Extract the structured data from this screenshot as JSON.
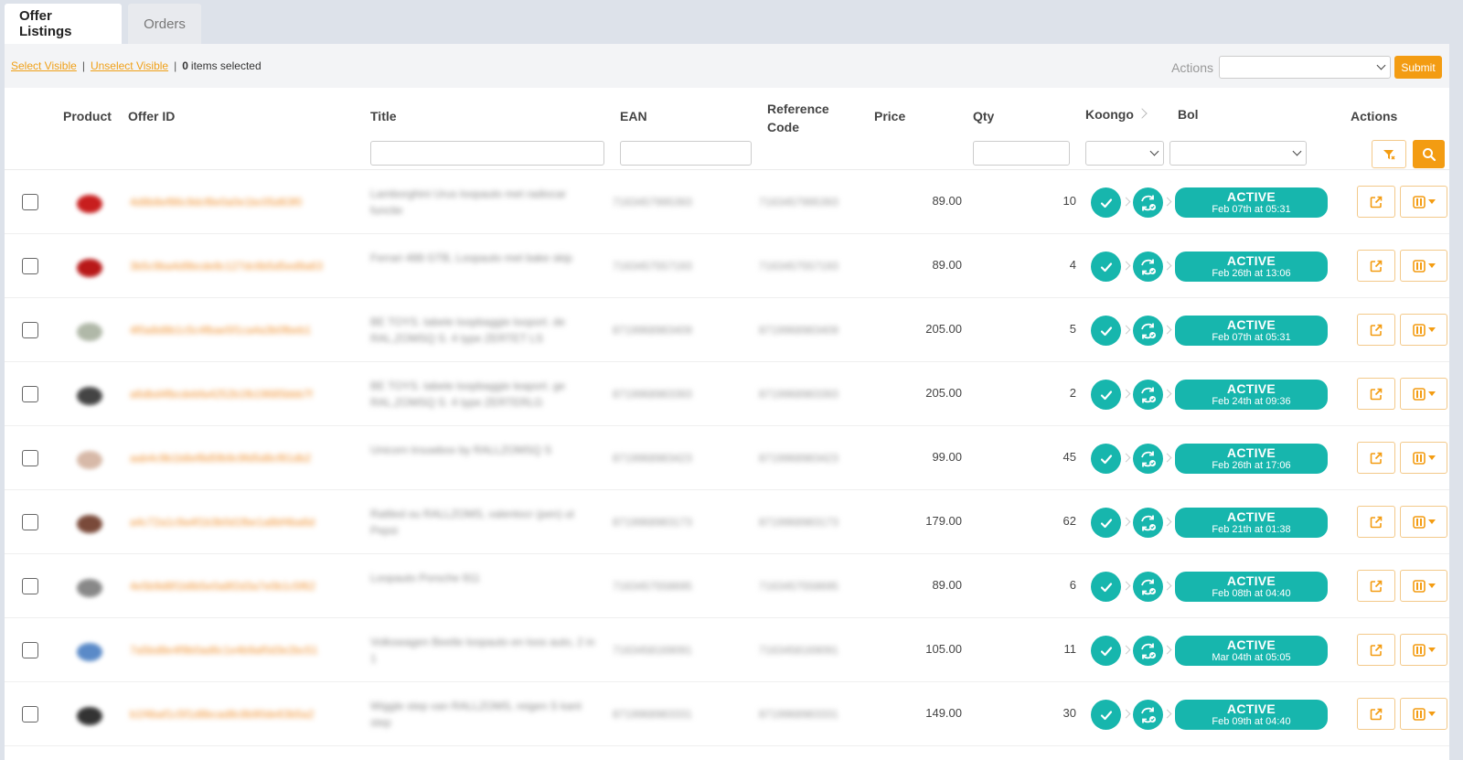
{
  "tabs": [
    {
      "label": "Offer Listings",
      "active": true
    },
    {
      "label": "Orders",
      "active": false
    }
  ],
  "toolbar": {
    "select_visible": "Select Visible",
    "unselect_visible": "Unselect Visible",
    "separator": "|",
    "selected_count": "0",
    "selected_suffix": "items selected",
    "actions_label": "Actions",
    "actions_value": "",
    "submit_label": "Submit"
  },
  "columns": {
    "product": "Product",
    "offer_id": "Offer ID",
    "title": "Title",
    "ean": "EAN",
    "reference_code_line1": "Reference",
    "reference_code_line2": "Code",
    "price": "Price",
    "qty": "Qty",
    "koongo": "Koongo",
    "bol": "Bol",
    "actions": "Actions"
  },
  "colors": {
    "accent": "#f39c12",
    "link": "#f0a018",
    "status_teal": "#17b6ad"
  },
  "rows": [
    {
      "thumb_color": "#c81e1e",
      "offer_id": "4d8b8ef86c9dcf8e0a0e1bc05d63f0",
      "title": "Lamborghini Urus loopauto met radiocar functie",
      "ean": "7163457995393",
      "ref": "7163457995393",
      "price": "89.00",
      "qty": "10",
      "status": "ACTIVE",
      "date": "Feb 07th at 05:31"
    },
    {
      "thumb_color": "#b81818",
      "offer_id": "3b5c9ba4d9bcde8c127dc6b5d5ed9a63",
      "title": "Ferrari 488 GTB, Loopauto met bake skip",
      "ean": "7163457557193",
      "ref": "7163457557193",
      "price": "89.00",
      "qty": "4",
      "status": "ACTIVE",
      "date": "Feb 26th at 13:06"
    },
    {
      "thumb_color": "#b0b8a8",
      "offer_id": "4f0a8d8b1c5c4fbae5f1ca4a3b0fbeb1",
      "title": "BE TOYS. tabele loopbaggie looport. de RAL,ZOMSQ S. 4 type ZERTET LS",
      "ean": "8719968983409",
      "ref": "8719968983409",
      "price": "205.00",
      "qty": "5",
      "status": "ACTIVE",
      "date": "Feb 07th at 05:31"
    },
    {
      "thumb_color": "#444444",
      "offer_id": "a6dbd4fbcdebfa4252b1fb19685bbb7f",
      "title": "BE TOYS. tabele loopbaggie leaport. ge RAL,ZOMSQ S. 4 type ZERTERLG",
      "ean": "8719968983393",
      "ref": "8719968983393",
      "price": "205.00",
      "qty": "2",
      "status": "ACTIVE",
      "date": "Feb 24th at 09:36"
    },
    {
      "thumb_color": "#d7b9a8",
      "offer_id": "aab4c9b1b8ef8d5fb9c9fd5d8cf81db2",
      "title": "Unicorn trouwbox by RALLZOMSQ S",
      "ean": "8719968983423",
      "ref": "8719968983423",
      "price": "99.00",
      "qty": "45",
      "status": "ACTIVE",
      "date": "Feb 26th at 17:06"
    },
    {
      "thumb_color": "#7a4a3a",
      "offer_id": "a4c72a1c9a4f1b3b0d1fbe1a8bf4ba6d",
      "title": "Rattled ou RALLZOMS, valentocr (pen) ut Pepsi",
      "ean": "8719968983173",
      "ref": "8719968983173",
      "price": "179.00",
      "qty": "62",
      "status": "ACTIVE",
      "date": "Feb 21th at 01:38"
    },
    {
      "thumb_color": "#888888",
      "offer_id": "4e5b9d8f1b8b5e0a8f2d3a7e0b1c5f62",
      "title": "Loopauto Porsche 911",
      "ean": "7163457558695",
      "ref": "7163457558695",
      "price": "89.00",
      "qty": "6",
      "status": "ACTIVE",
      "date": "Feb 08th at 04:40"
    },
    {
      "thumb_color": "#5a8ac8",
      "offer_id": "7a5bd8e4f9b0ad6c1e4b9af0d3e2bc51",
      "title": "Volkswagen Beetle loopauto en loos auto, 2 in 1",
      "ean": "7163458169091",
      "ref": "7163458169091",
      "price": "105.00",
      "qty": "11",
      "status": "ACTIVE",
      "date": "Mar 04th at 05:05"
    },
    {
      "thumb_color": "#333333",
      "offer_id": "b1f4baf1c5f1d8bcad8c8b90de63b5a2",
      "title": "Wiggle step van RALLZOMS, reigen S kant step",
      "ean": "8719968983331",
      "ref": "8719968983331",
      "price": "149.00",
      "qty": "30",
      "status": "ACTIVE",
      "date": "Feb 09th at 04:40"
    }
  ]
}
